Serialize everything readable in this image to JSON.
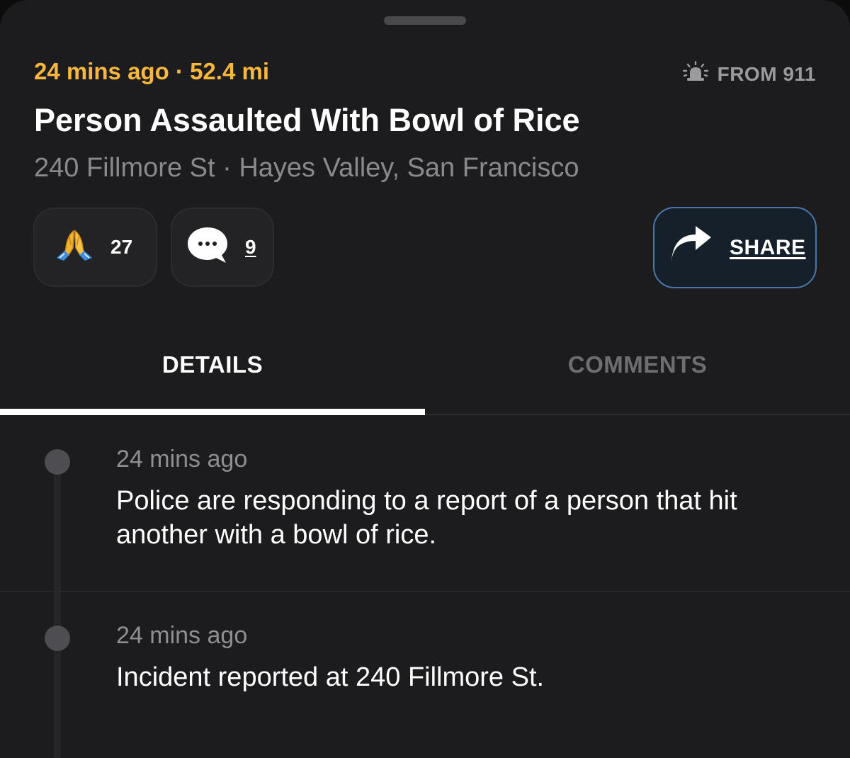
{
  "incident": {
    "time_ago": "24 mins ago",
    "separator": "·",
    "distance": "52.4 mi",
    "source_label": "FROM 911",
    "source_icon": "siren-icon",
    "title": "Person Assaulted With Bowl of Rice",
    "street": "240 Fillmore St",
    "area": "Hayes Valley, San Francisco"
  },
  "actions": {
    "reactions": {
      "icon": "praying-hands-icon",
      "count": "27"
    },
    "comments": {
      "icon": "speech-bubble-icon",
      "count": "9"
    },
    "share": {
      "icon": "share-arrow-icon",
      "label": "SHARE"
    }
  },
  "tabs": [
    {
      "label": "DETAILS",
      "active": true
    },
    {
      "label": "COMMENTS",
      "active": false
    }
  ],
  "updates": [
    {
      "time": "24 mins ago",
      "text": "Police are responding to a report of a person that hit another with a bowl of rice."
    },
    {
      "time": "24 mins ago",
      "text": "Incident reported at 240 Fillmore St."
    }
  ],
  "colors": {
    "accent": "#f6b73c",
    "background": "#1c1c1e",
    "share_border": "#4a78a8"
  }
}
